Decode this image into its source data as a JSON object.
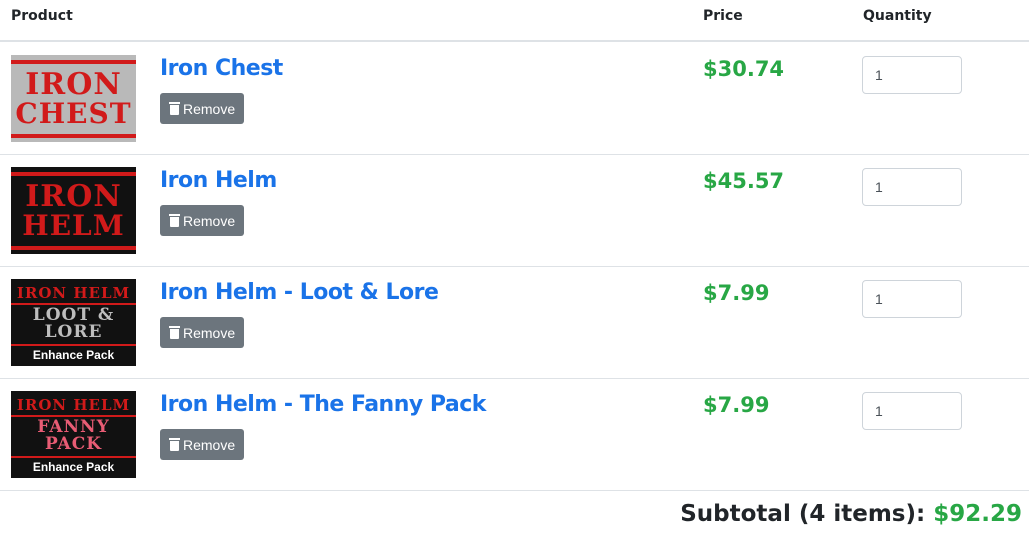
{
  "table": {
    "headers": {
      "product": "Product",
      "price": "Price",
      "quantity": "Quantity"
    }
  },
  "items": [
    {
      "name": "Iron Chest",
      "price": "$30.74",
      "quantity": "1",
      "remove_label": "Remove",
      "thumb": {
        "line1": "IRON",
        "line2": "CHEST",
        "pack": "",
        "bg": "#b9b9b9",
        "color": "#d11a1a"
      }
    },
    {
      "name": "Iron Helm",
      "price": "$45.57",
      "quantity": "1",
      "remove_label": "Remove",
      "thumb": {
        "line1": "IRON",
        "line2": "HELM",
        "pack": "",
        "bg": "#111111",
        "color": "#d11a1a"
      }
    },
    {
      "name": "Iron Helm - Loot & Lore",
      "price": "$7.99",
      "quantity": "1",
      "remove_label": "Remove",
      "thumb": {
        "line1": "IRON HELM",
        "line2": "LOOT & LORE",
        "pack": "Enhance Pack",
        "bg": "#111111",
        "color": "#bdbdbd"
      }
    },
    {
      "name": "Iron Helm - The Fanny Pack",
      "price": "$7.99",
      "quantity": "1",
      "remove_label": "Remove",
      "thumb": {
        "line1": "IRON HELM",
        "line2": "FANNY PACK",
        "pack": "Enhance Pack",
        "bg": "#111111",
        "color": "#e85c74"
      }
    }
  ],
  "subtotal": {
    "label": "Subtotal (4 items):",
    "amount": "$92.29"
  },
  "colors": {
    "link": "#1a73e8",
    "price": "#28a745",
    "button": "#6c757d",
    "brand_red": "#d11a1a"
  }
}
